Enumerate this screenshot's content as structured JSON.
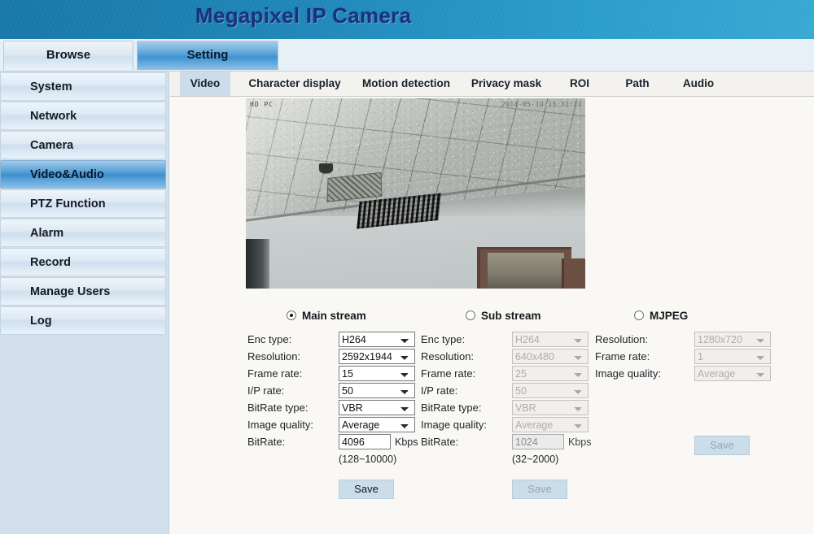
{
  "header": {
    "title": "Megapixel IP Camera"
  },
  "topnav": {
    "browse": "Browse",
    "setting": "Setting"
  },
  "sidebar": {
    "items": [
      {
        "label": "System"
      },
      {
        "label": "Network"
      },
      {
        "label": "Camera"
      },
      {
        "label": "Video&Audio"
      },
      {
        "label": "PTZ Function"
      },
      {
        "label": "Alarm"
      },
      {
        "label": "Record"
      },
      {
        "label": "Manage Users"
      },
      {
        "label": "Log"
      }
    ],
    "active_index": 3
  },
  "tabs": [
    {
      "label": "Video",
      "active": true
    },
    {
      "label": "Character display",
      "active": false
    },
    {
      "label": "Motion detection",
      "active": false
    },
    {
      "label": "Privacy mask",
      "active": false
    },
    {
      "label": "ROI",
      "active": false
    },
    {
      "label": "Path",
      "active": false
    },
    {
      "label": "Audio",
      "active": false
    }
  ],
  "video": {
    "osd_logo": "HD  PC",
    "osd_timestamp": "2014-05-10 13:32:12"
  },
  "streams": {
    "main": {
      "radio_label": "Main stream",
      "selected": true,
      "labels": {
        "enc_type": "Enc type:",
        "resolution": "Resolution:",
        "frame_rate": "Frame rate:",
        "ip_rate": "I/P rate:",
        "bitrate_type": "BitRate type:",
        "image_quality": "Image quality:",
        "bitrate": "BitRate:"
      },
      "values": {
        "enc_type": "H264",
        "resolution": "2592x1944",
        "frame_rate": "15",
        "ip_rate": "50",
        "bitrate_type": "VBR",
        "image_quality": "Average",
        "bitrate": "4096"
      },
      "unit": "Kbps",
      "range_hint": "(128~10000)",
      "save_label": "Save",
      "enabled": true
    },
    "sub": {
      "radio_label": "Sub stream",
      "selected": false,
      "labels": {
        "enc_type": "Enc type:",
        "resolution": "Resolution:",
        "frame_rate": "Frame rate:",
        "ip_rate": "I/P rate:",
        "bitrate_type": "BitRate type:",
        "image_quality": "Image quality:",
        "bitrate": "BitRate:"
      },
      "values": {
        "enc_type": "H264",
        "resolution": "640x480",
        "frame_rate": "25",
        "ip_rate": "50",
        "bitrate_type": "VBR",
        "image_quality": "Average",
        "bitrate": "1024"
      },
      "unit": "Kbps",
      "range_hint": "(32~2000)",
      "save_label": "Save",
      "enabled": false
    },
    "mjpeg": {
      "radio_label": "MJPEG",
      "selected": false,
      "labels": {
        "resolution": "Resolution:",
        "frame_rate": "Frame rate:",
        "image_quality": "Image quality:"
      },
      "values": {
        "resolution": "1280x720",
        "frame_rate": "1",
        "image_quality": "Average"
      },
      "save_label": "Save",
      "enabled": false
    }
  },
  "colors": {
    "banner_blue": "#1f86b8",
    "title_navy": "#17307e",
    "sidebar_bg": "#d3e0ec",
    "active_item": "#539ed5",
    "content_bg": "#faf8f5",
    "tab_active": "#ccdcea",
    "save_button": "#ccddea"
  }
}
